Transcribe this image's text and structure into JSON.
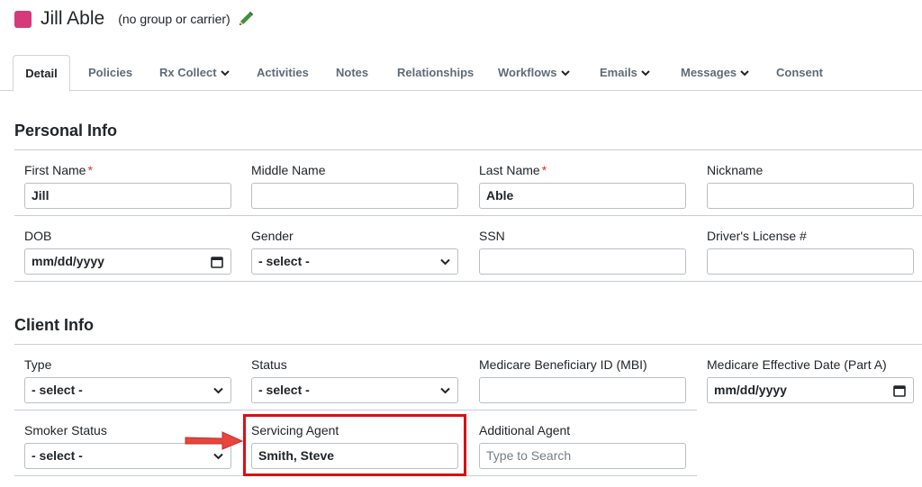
{
  "client": {
    "name": "Jill Able",
    "group": "(no group or carrier)",
    "color": "#d63a7a"
  },
  "tabs": [
    {
      "label": "Detail",
      "active": true
    },
    {
      "label": "Policies"
    },
    {
      "label": "Rx Collect",
      "dropdown": true
    },
    {
      "label": "Activities"
    },
    {
      "label": "Notes"
    },
    {
      "label": "Relationships"
    },
    {
      "label": "Workflows",
      "dropdown": true
    },
    {
      "label": "Emails",
      "dropdown": true
    },
    {
      "label": "Messages",
      "dropdown": true
    },
    {
      "label": "Consent"
    }
  ],
  "personal_info": {
    "title": "Personal Info",
    "first_name": {
      "label": "First Name",
      "required": "*",
      "value": "Jill"
    },
    "middle_name": {
      "label": "Middle Name",
      "value": ""
    },
    "last_name": {
      "label": "Last Name",
      "required": "*",
      "value": "Able"
    },
    "nickname": {
      "label": "Nickname",
      "value": ""
    },
    "dob": {
      "label": "DOB",
      "value": "mm/dd/yyyy"
    },
    "gender": {
      "label": "Gender",
      "value": "- select -"
    },
    "ssn": {
      "label": "SSN",
      "value": ""
    },
    "drivers_license": {
      "label": "Driver's License #",
      "value": ""
    }
  },
  "client_info": {
    "title": "Client Info",
    "type": {
      "label": "Type",
      "value": "- select -"
    },
    "status": {
      "label": "Status",
      "value": "- select -"
    },
    "mbi": {
      "label": "Medicare Beneficiary ID (MBI)",
      "value": ""
    },
    "medicare_date": {
      "label": "Medicare Effective Date (Part A)",
      "value": "mm/dd/yyyy"
    },
    "smoker_status": {
      "label": "Smoker Status",
      "value": "- select -"
    },
    "servicing_agent": {
      "label": "Servicing Agent",
      "value": "Smith, Steve"
    },
    "additional_agent": {
      "label": "Additional Agent",
      "placeholder": "Type to Search"
    }
  },
  "colors": {
    "accent_highlight": "#d9100f",
    "arrow": "#e8453c",
    "required": "#d9322e"
  }
}
